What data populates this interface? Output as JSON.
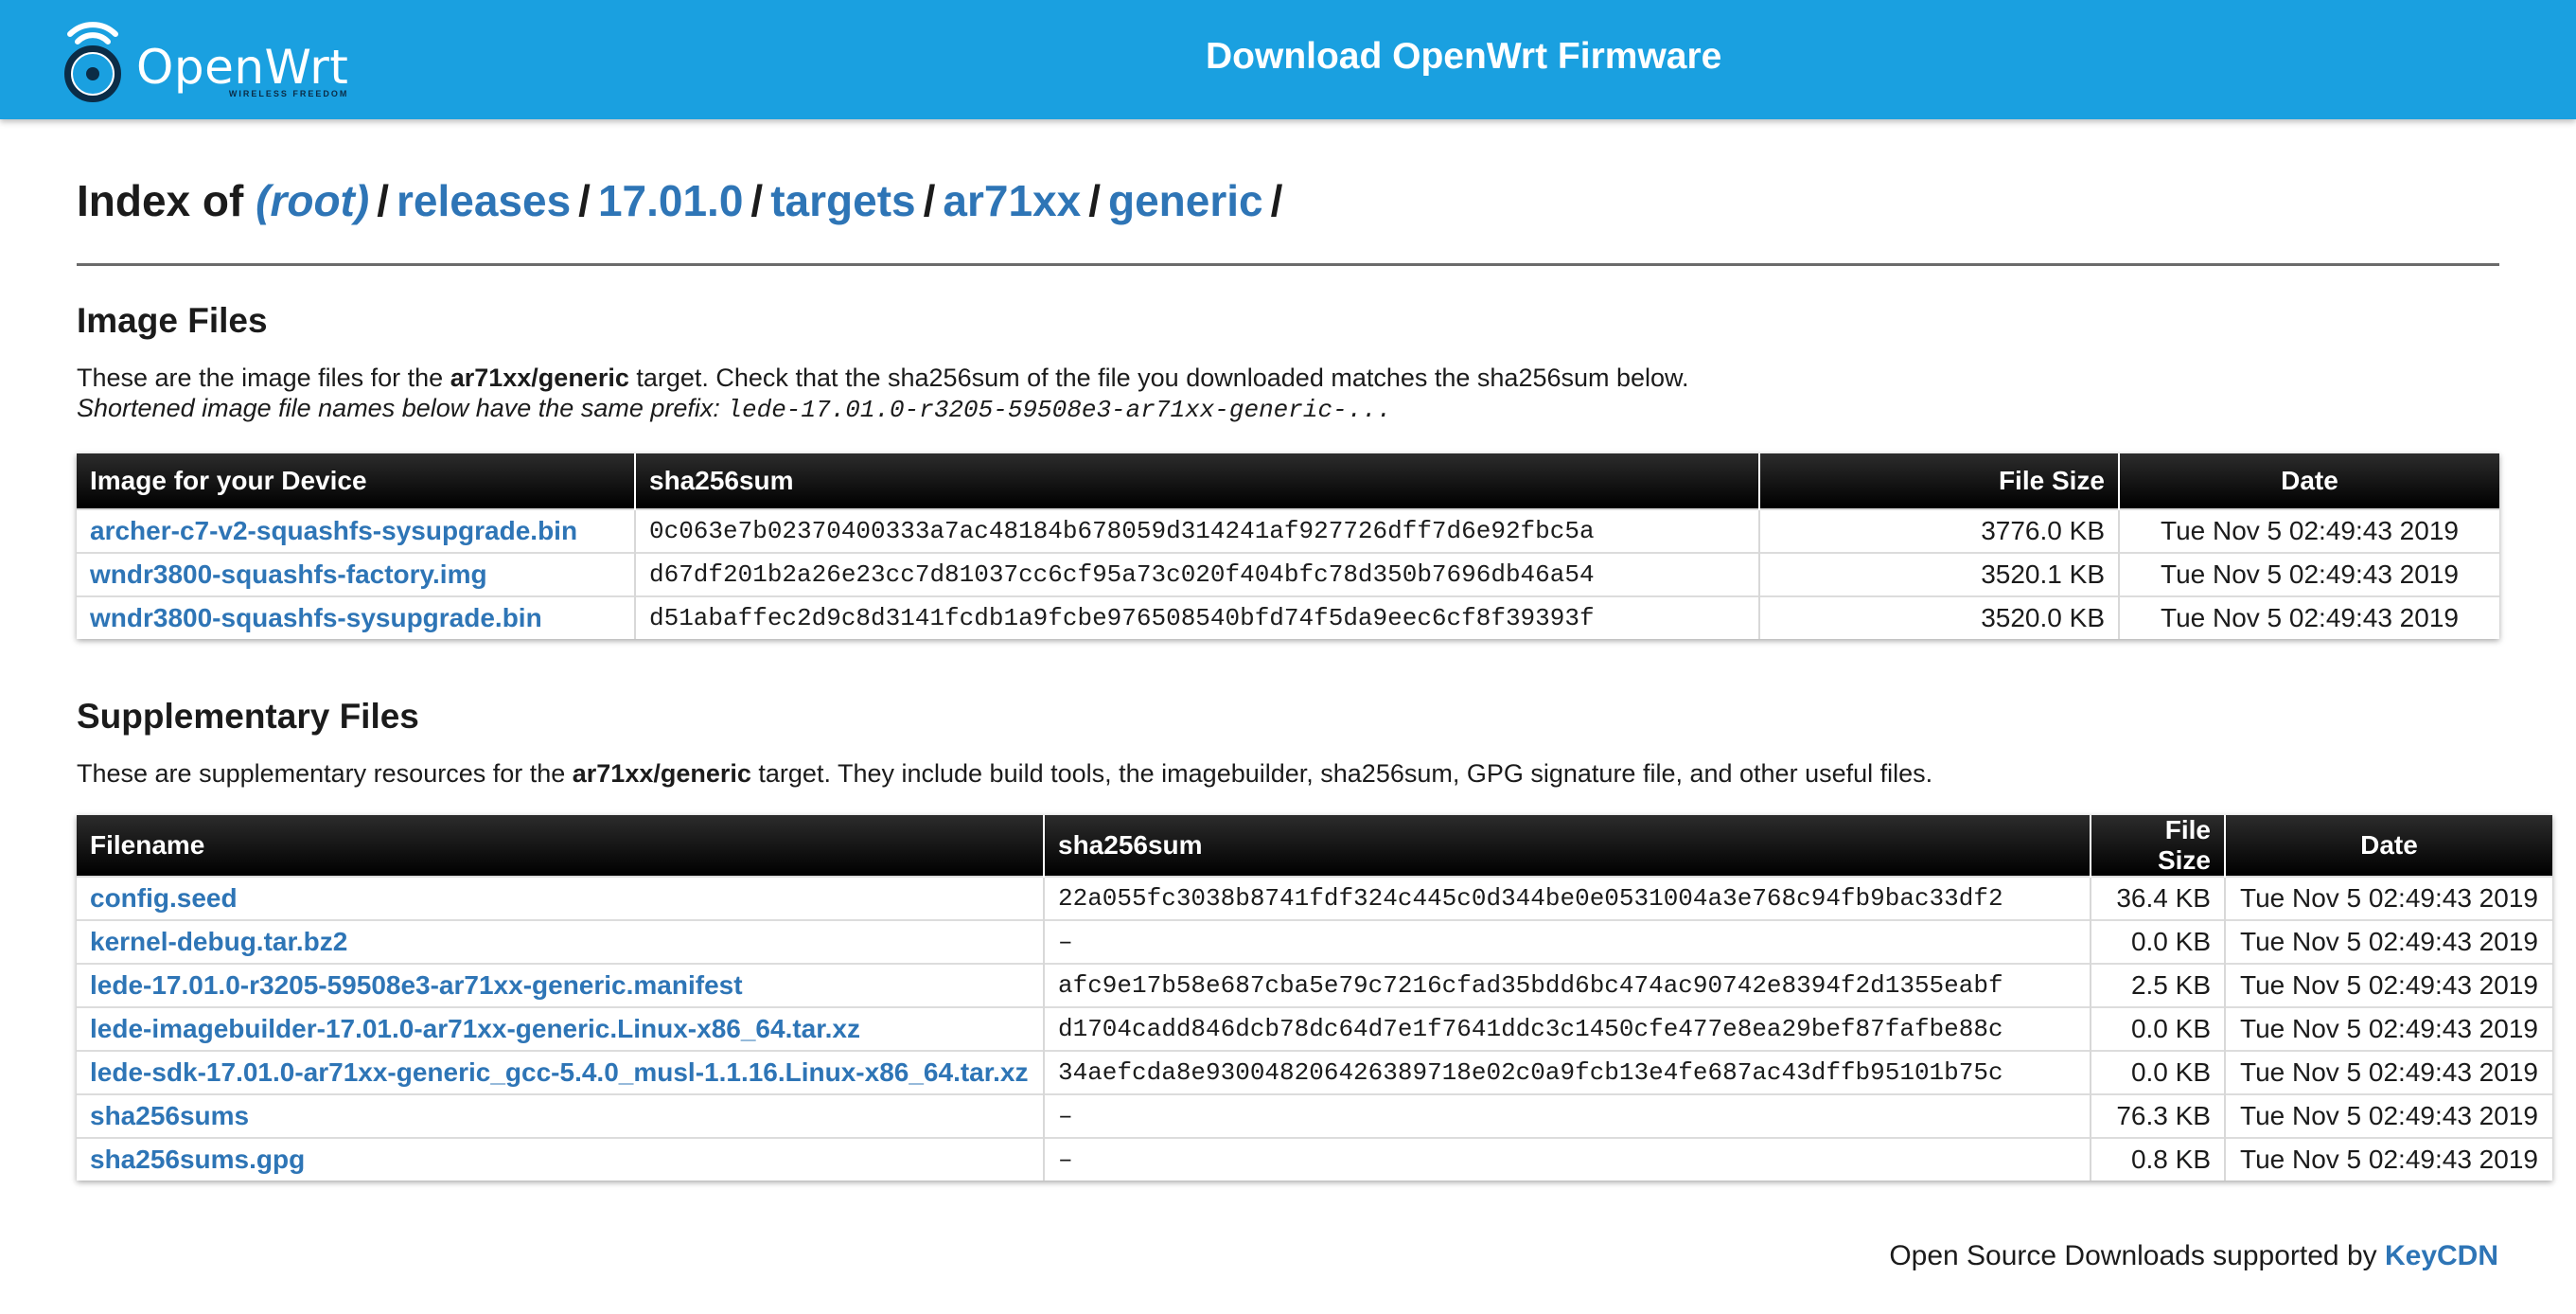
{
  "header": {
    "logo_name": "OpenWrt",
    "logo_tagline": "WIRELESS FREEDOM",
    "title": "Download OpenWrt Firmware"
  },
  "breadcrumb": {
    "prefix": "Index of",
    "items": [
      "(root)",
      "releases",
      "17.01.0",
      "targets",
      "ar71xx",
      "generic"
    ],
    "separator": "/"
  },
  "image_section": {
    "title": "Image Files",
    "desc_pre": "These are the image files for the ",
    "desc_target": "ar71xx/generic",
    "desc_post": " target. Check that the sha256sum of the file you downloaded matches the sha256sum below.",
    "prefix_note": "Shortened image file names below have the same prefix: ",
    "prefix_value": "lede-17.01.0-r3205-59508e3-ar71xx-generic-...",
    "columns": [
      "Image for your Device",
      "sha256sum",
      "File Size",
      "Date"
    ],
    "rows": [
      {
        "name": "archer-c7-v2-squashfs-sysupgrade.bin",
        "sha": "0c063e7b02370400333a7ac48184b678059d314241af927726dff7d6e92fbc5a",
        "size": "3776.0 KB",
        "date": "Tue Nov 5 02:49:43 2019"
      },
      {
        "name": "wndr3800-squashfs-factory.img",
        "sha": "d67df201b2a26e23cc7d81037cc6cf95a73c020f404bfc78d350b7696db46a54",
        "size": "3520.1 KB",
        "date": "Tue Nov 5 02:49:43 2019"
      },
      {
        "name": "wndr3800-squashfs-sysupgrade.bin",
        "sha": "d51abaffec2d9c8d3141fcdb1a9fcbe976508540bfd74f5da9eec6cf8f39393f",
        "size": "3520.0 KB",
        "date": "Tue Nov 5 02:49:43 2019"
      }
    ]
  },
  "supp_section": {
    "title": "Supplementary Files",
    "desc_pre": "These are supplementary resources for the ",
    "desc_target": "ar71xx/generic",
    "desc_post": " target. They include build tools, the imagebuilder, sha256sum, GPG signature file, and other useful files.",
    "columns": [
      "Filename",
      "sha256sum",
      "File Size",
      "Date"
    ],
    "rows": [
      {
        "name": "config.seed",
        "sha": "22a055fc3038b8741fdf324c445c0d344be0e0531004a3e768c94fb9bac33df2",
        "size": "36.4 KB",
        "date": "Tue Nov 5 02:49:43 2019"
      },
      {
        "name": "kernel-debug.tar.bz2",
        "sha": "–",
        "size": "0.0 KB",
        "date": "Tue Nov 5 02:49:43 2019"
      },
      {
        "name": "lede-17.01.0-r3205-59508e3-ar71xx-generic.manifest",
        "sha": "afc9e17b58e687cba5e79c7216cfad35bdd6bc474ac90742e8394f2d1355eabf",
        "size": "2.5 KB",
        "date": "Tue Nov 5 02:49:43 2019"
      },
      {
        "name": "lede-imagebuilder-17.01.0-ar71xx-generic.Linux-x86_64.tar.xz",
        "sha": "d1704cadd846dcb78dc64d7e1f7641ddc3c1450cfe477e8ea29bef87fafbe88c",
        "size": "0.0 KB",
        "date": "Tue Nov 5 02:49:43 2019"
      },
      {
        "name": "lede-sdk-17.01.0-ar71xx-generic_gcc-5.4.0_musl-1.1.16.Linux-x86_64.tar.xz",
        "sha": "34aefcda8e930048206426389718e02c0a9fcb13e4fe687ac43dffb95101b75c",
        "size": "0.0 KB",
        "date": "Tue Nov 5 02:49:43 2019"
      },
      {
        "name": "sha256sums",
        "sha": "–",
        "size": "76.3 KB",
        "date": "Tue Nov 5 02:49:43 2019"
      },
      {
        "name": "sha256sums.gpg",
        "sha": "–",
        "size": "0.8 KB",
        "date": "Tue Nov 5 02:49:43 2019"
      }
    ]
  },
  "footer": {
    "text": "Open Source Downloads supported by ",
    "link": "KeyCDN"
  },
  "colors": {
    "header_bg": "#1aa0e0",
    "link": "#2e75b6",
    "table_header": "#000000"
  },
  "icons": [
    "openwrt-wifi-logo-icon"
  ]
}
